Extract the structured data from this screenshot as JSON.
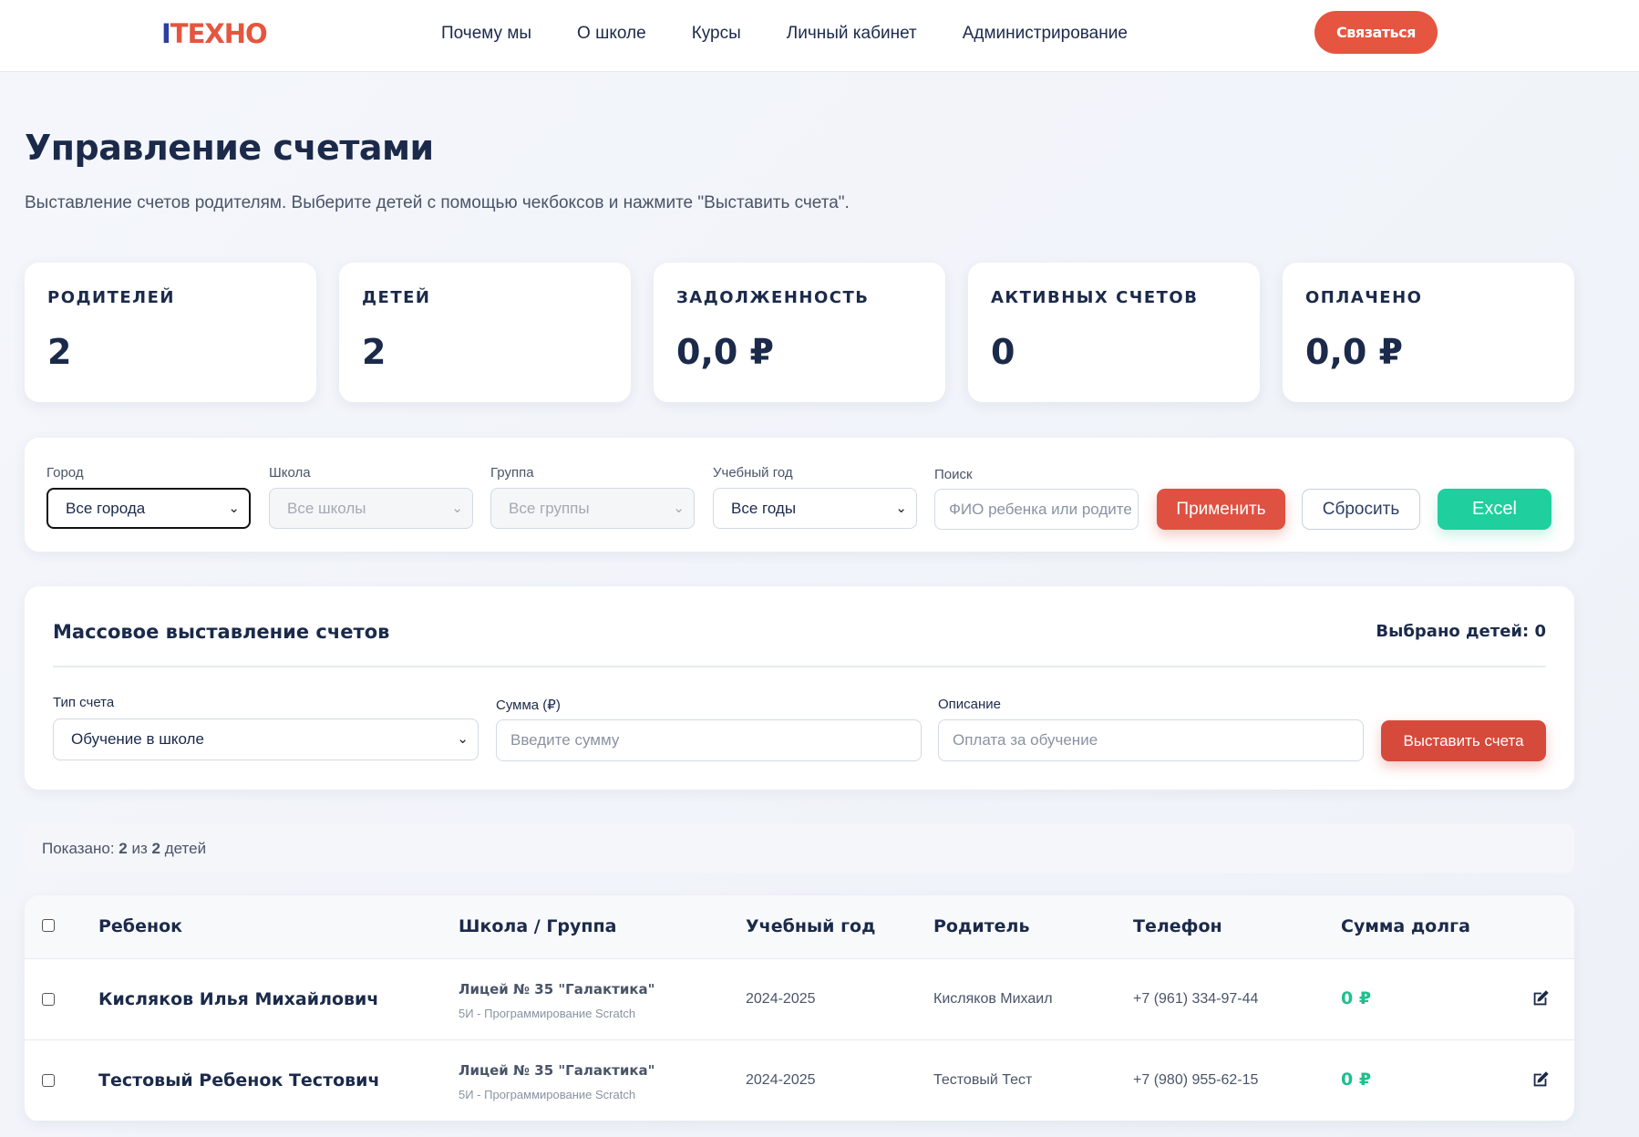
{
  "header": {
    "logo_part1": "I",
    "logo_part2": "TEXHO",
    "nav": [
      "Почему мы",
      "О школе",
      "Курсы",
      "Личный кабинет",
      "Администрирование"
    ],
    "contact_button": "Связаться"
  },
  "page": {
    "title": "Управление счетами",
    "subtitle": "Выставление счетов родителям. Выберите детей с помощью чекбоксов и нажмите \"Выставить счета\"."
  },
  "stats": [
    {
      "label": "РОДИТЕЛЕЙ",
      "value": "2"
    },
    {
      "label": "ДЕТЕЙ",
      "value": "2"
    },
    {
      "label": "ЗАДОЛЖЕННОСТЬ",
      "value": "0,0 ₽"
    },
    {
      "label": "АКТИВНЫХ СЧЕТОВ",
      "value": "0"
    },
    {
      "label": "ОПЛАЧЕНО",
      "value": "0,0 ₽"
    }
  ],
  "filters": {
    "city_label": "Город",
    "city_value": "Все города",
    "school_label": "Школа",
    "school_value": "Все школы",
    "group_label": "Группа",
    "group_value": "Все группы",
    "year_label": "Учебный год",
    "year_value": "Все годы",
    "search_label": "Поиск",
    "search_placeholder": "ФИО ребенка или родите",
    "apply": "Применить",
    "reset": "Сбросить",
    "excel": "Excel"
  },
  "mass": {
    "title": "Массовое выставление счетов",
    "selected": "Выбрано детей: 0",
    "type_label": "Тип счета",
    "type_value": "Обучение в школе",
    "amount_label": "Сумма (₽)",
    "amount_placeholder": "Введите сумму",
    "desc_label": "Описание",
    "desc_placeholder": "Оплата за обучение",
    "submit": "Выставить счета"
  },
  "showing": {
    "prefix": "Показано: ",
    "shown": "2",
    "middle": " из ",
    "total": "2",
    "suffix": " детей"
  },
  "table": {
    "headers": [
      "Ребенок",
      "Школа / Группа",
      "Учебный год",
      "Родитель",
      "Телефон",
      "Сумма долга"
    ],
    "rows": [
      {
        "child": "Кисляков Илья Михайлович",
        "school": "Лицей № 35 \"Галактика\"",
        "group": "5И - Программирование Scratch",
        "year": "2024-2025",
        "parent": "Кисляков Михаил",
        "phone": "+7 (961) 334-97-44",
        "debt": "0 ₽"
      },
      {
        "child": "Тестовый Ребенок Тестович",
        "school": "Лицей № 35 \"Галактика\"",
        "group": "5И - Программирование Scratch",
        "year": "2024-2025",
        "parent": "Тестовый Тест",
        "phone": "+7 (980) 955-62-15",
        "debt": "0 ₽"
      }
    ]
  }
}
